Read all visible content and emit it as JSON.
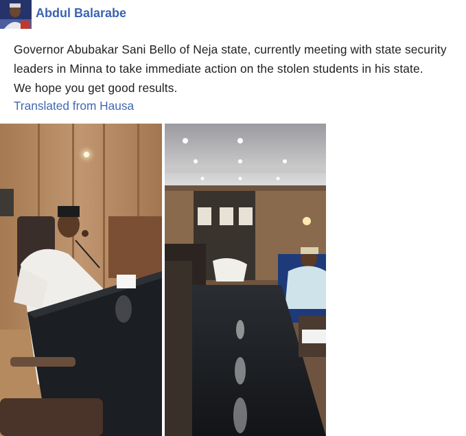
{
  "post": {
    "author": "Abdul Balarabe",
    "text_lines": [
      "Governor Abubakar Sani Bello of Neja state, currently meeting with state security",
      "leaders in Minna to take immediate action on the stolen students in his state.",
      "We hope you get good results."
    ],
    "translation_link": "Translated from Hausa"
  },
  "colors": {
    "author": "#3b63b3",
    "link": "#4267b2",
    "text": "#1c1e21"
  }
}
